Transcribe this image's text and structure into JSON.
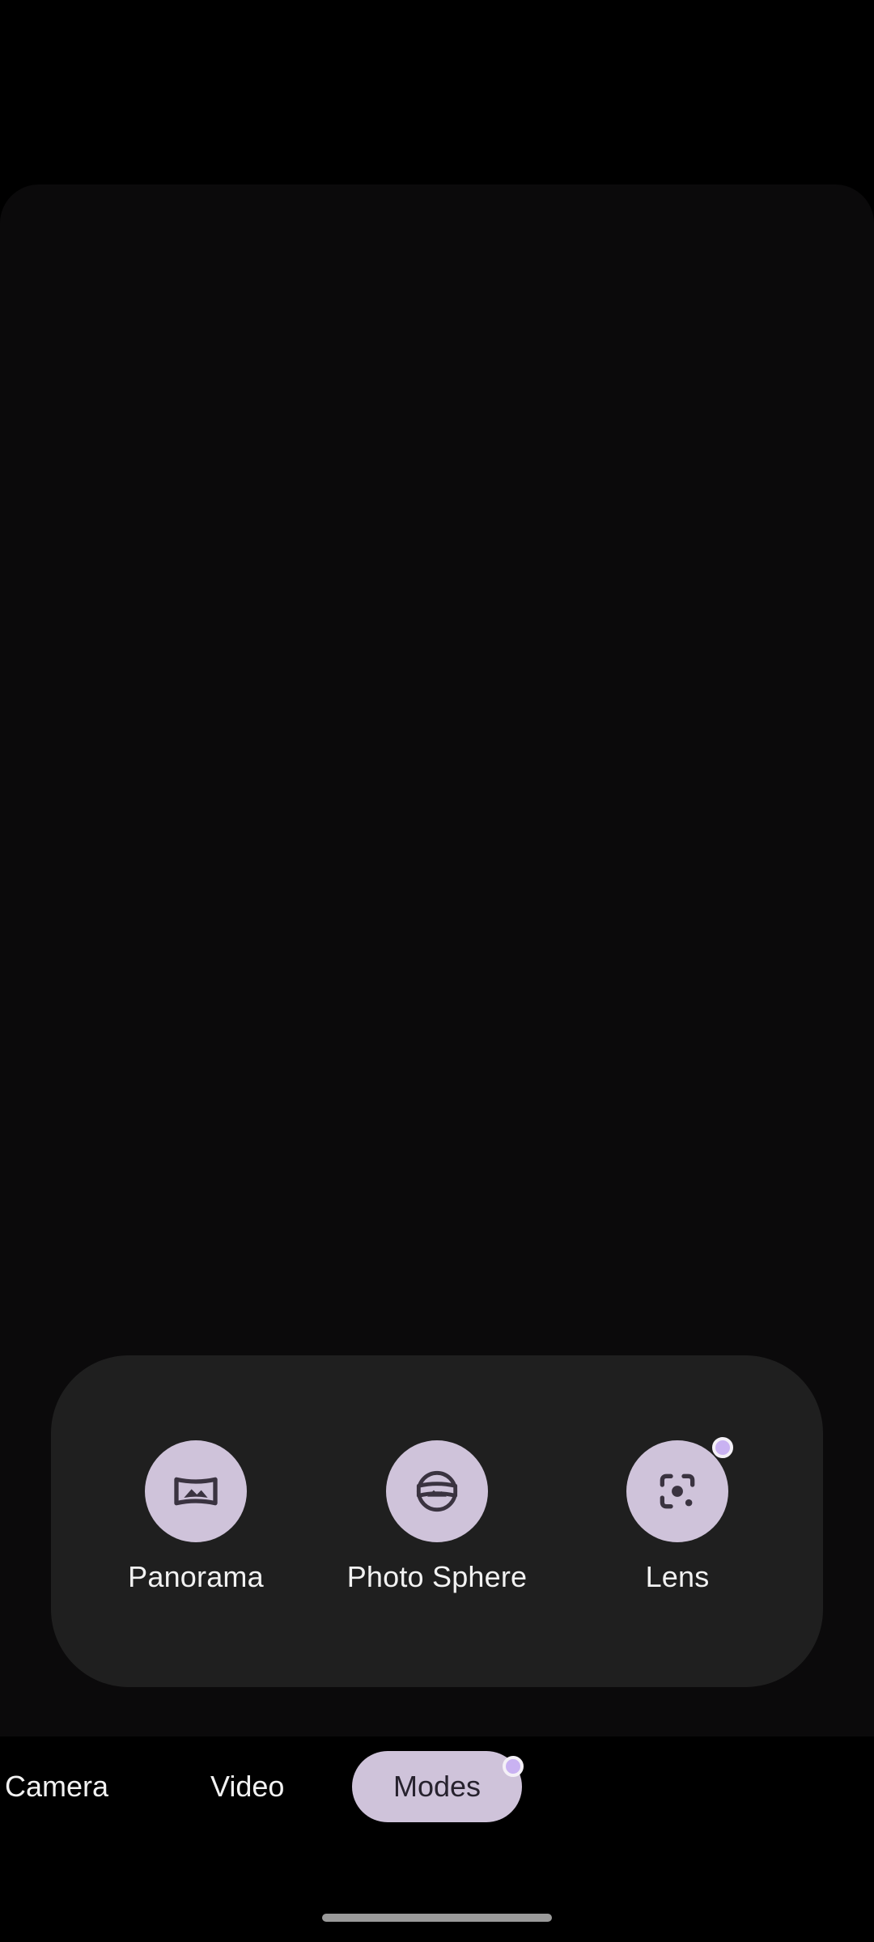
{
  "modes_panel": {
    "items": [
      {
        "label": "Panorama",
        "icon": "panorama-icon",
        "new_badge": false
      },
      {
        "label": "Photo Sphere",
        "icon": "photo-sphere-icon",
        "new_badge": false
      },
      {
        "label": "Lens",
        "icon": "lens-icon",
        "new_badge": true
      }
    ]
  },
  "tabs": {
    "camera": "Camera",
    "video": "Video",
    "modes": "Modes",
    "selected": "Modes"
  },
  "colors": {
    "accent": "#cfc3da",
    "panel": "#1f1f1f",
    "badge": "#c9b2f2",
    "background": "#000000"
  }
}
